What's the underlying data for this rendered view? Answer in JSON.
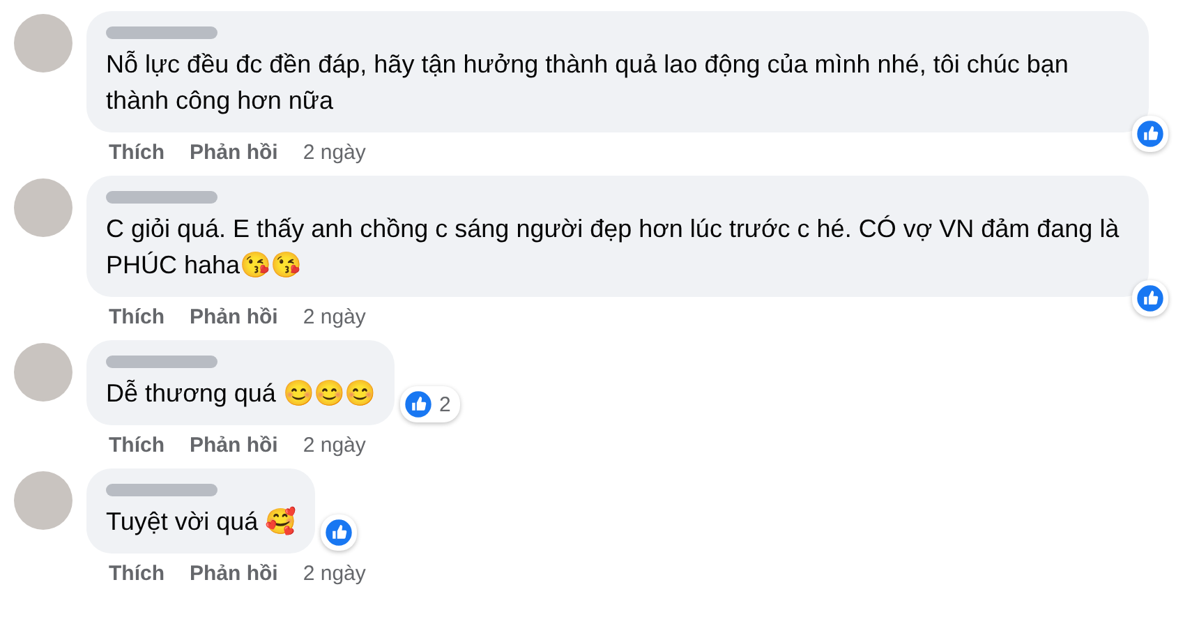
{
  "comments": [
    {
      "text": "Nỗ lực đều đc đền đáp, hãy tận hưởng thành quả lao động của mình nhé, tôi chúc bạn thành công hơn nữa",
      "reaction": {
        "kind": "corner"
      },
      "actions": [
        {
          "kind": "link",
          "label": "Thích"
        },
        {
          "kind": "link",
          "label": "Phản hồi"
        },
        {
          "kind": "time",
          "label": "2 ngày"
        }
      ]
    },
    {
      "text": "C giỏi quá. E thấy anh chồng c sáng người đẹp hơn lúc trước c hé. CÓ vợ VN đảm đang là PHÚC haha😘😘",
      "reaction": {
        "kind": "corner"
      },
      "actions": [
        {
          "kind": "link",
          "label": "Thích"
        },
        {
          "kind": "link",
          "label": "Phản hồi"
        },
        {
          "kind": "time",
          "label": "2 ngày"
        }
      ]
    },
    {
      "text": "Dễ thương quá 😊😊😊",
      "reaction": {
        "kind": "side",
        "count": "2"
      },
      "actions": [
        {
          "kind": "link",
          "label": "Thích"
        },
        {
          "kind": "link",
          "label": "Phản hồi"
        },
        {
          "kind": "time",
          "label": "2 ngày"
        }
      ]
    },
    {
      "text": "Tuyệt vời quá 🥰",
      "reaction": {
        "kind": "side"
      },
      "actions": [
        {
          "kind": "link",
          "label": "Thích"
        },
        {
          "kind": "link",
          "label": "Phản hồi"
        },
        {
          "kind": "time",
          "label": "2 ngày"
        }
      ]
    }
  ]
}
